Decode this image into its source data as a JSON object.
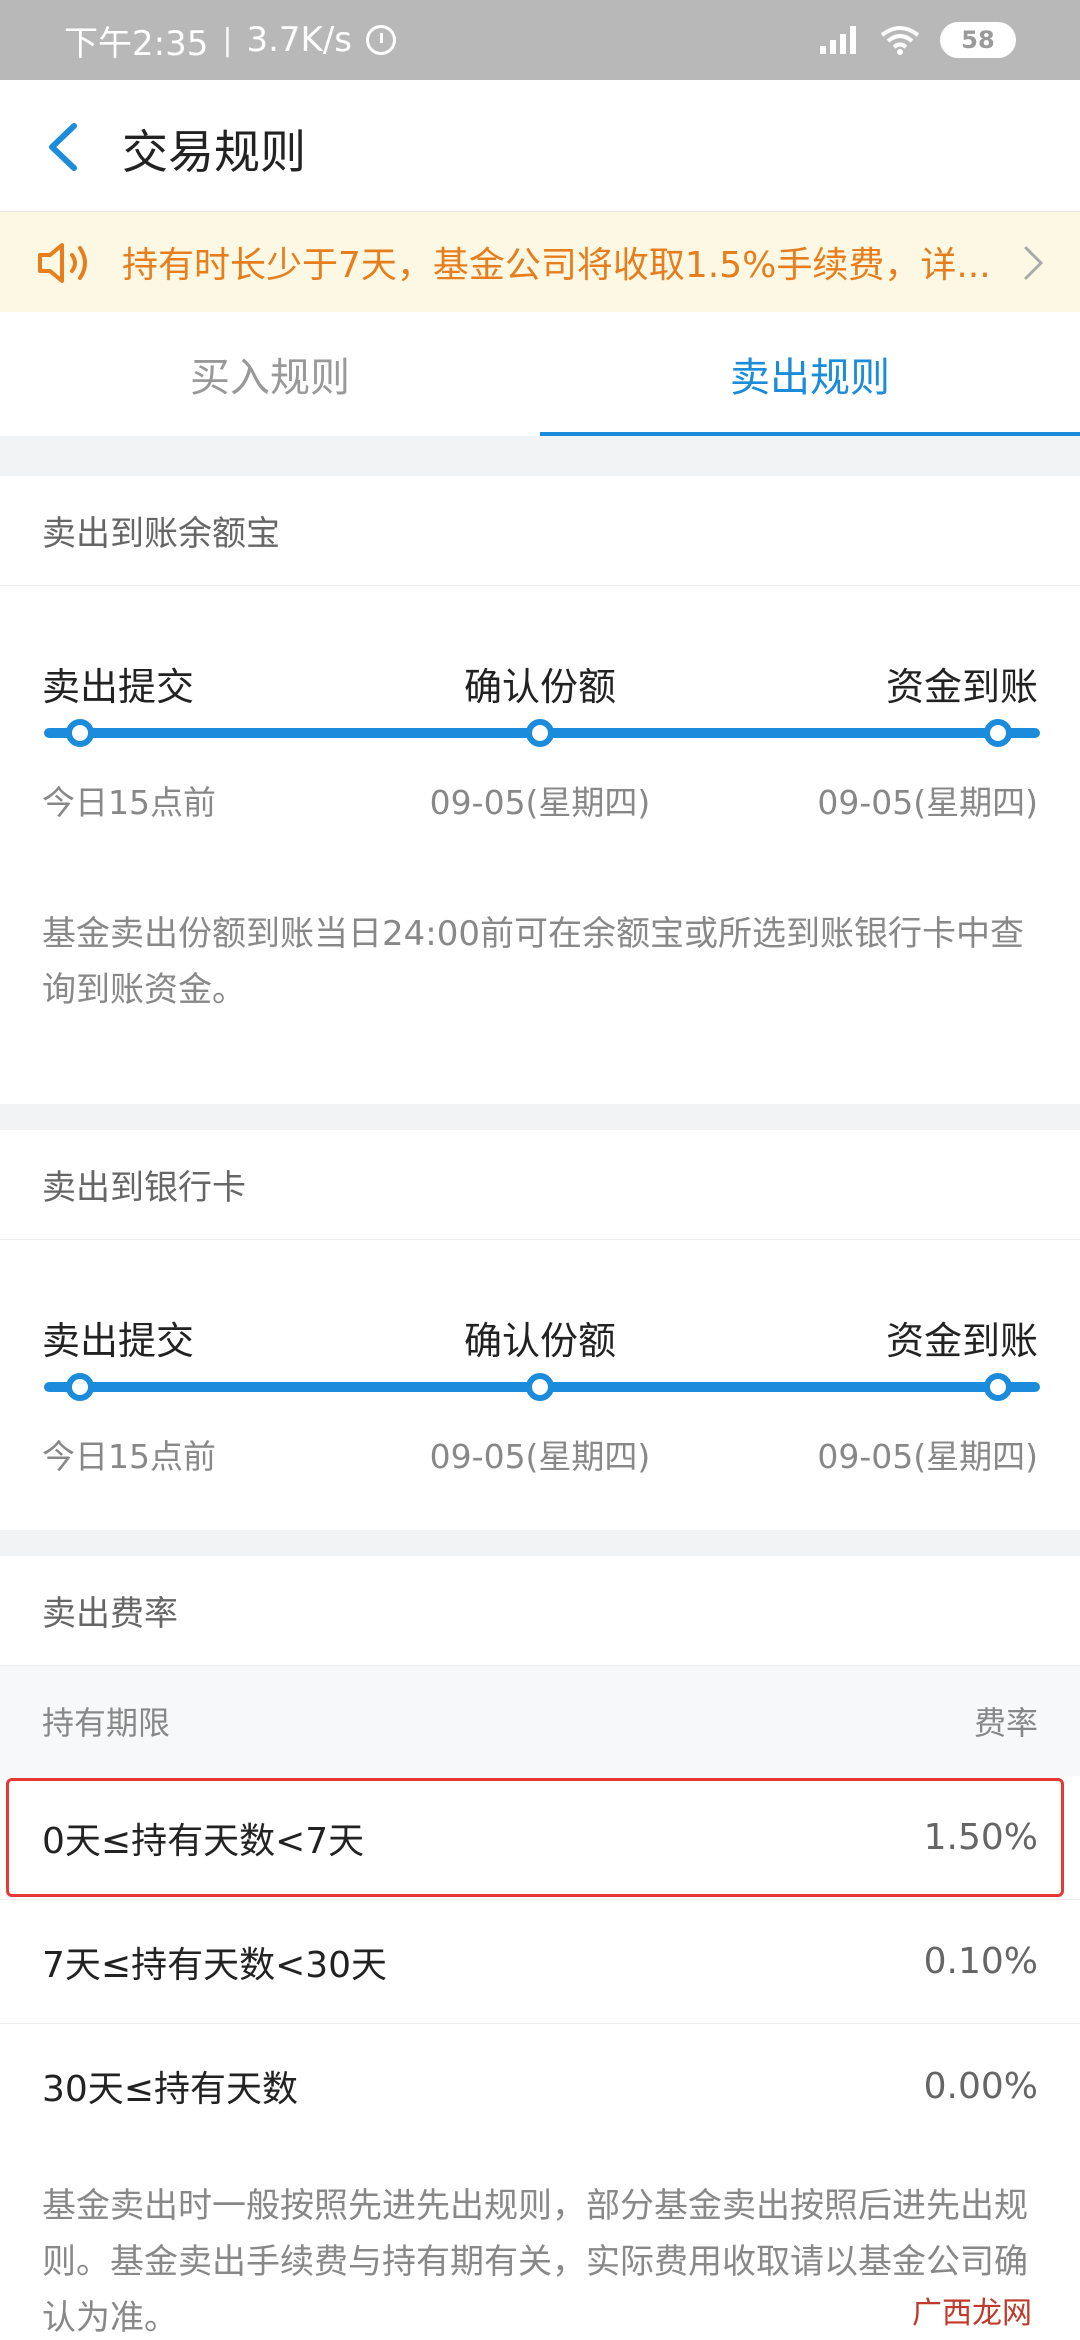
{
  "status_bar": {
    "time": "下午2:35",
    "speed": "3.7K/s",
    "battery": "58"
  },
  "header": {
    "title": "交易规则"
  },
  "notice": {
    "text": "持有时长少于7天，基金公司将收取1.5%手续费，详..."
  },
  "tabs": [
    {
      "label": "买入规则",
      "active": false
    },
    {
      "label": "卖出规则",
      "active": true
    }
  ],
  "sections": {
    "yuebao": {
      "title": "卖出到账余额宝",
      "steps": [
        {
          "label": "卖出提交",
          "date": "今日15点前"
        },
        {
          "label": "确认份额",
          "date": "09-05(星期四)"
        },
        {
          "label": "资金到账",
          "date": "09-05(星期四)"
        }
      ],
      "note": "基金卖出份额到账当日24:00前可在余额宝或所选到账银行卡中查询到账资金。"
    },
    "bank": {
      "title": "卖出到银行卡",
      "steps": [
        {
          "label": "卖出提交",
          "date": "今日15点前"
        },
        {
          "label": "确认份额",
          "date": "09-05(星期四)"
        },
        {
          "label": "资金到账",
          "date": "09-05(星期四)"
        }
      ]
    },
    "fee": {
      "title": "卖出费率",
      "col_period": "持有期限",
      "col_rate": "费率",
      "rows": [
        {
          "period": "0天≤持有天数<7天",
          "rate": "1.50%"
        },
        {
          "period": "7天≤持有天数<30天",
          "rate": "0.10%"
        },
        {
          "period": "30天≤持有天数",
          "rate": "0.00%"
        }
      ],
      "note": "基金卖出时一般按照先进先出规则，部分基金卖出按照后进先出规则。基金卖出手续费与持有期有关，实际费用收取请以基金公司确认为准。"
    }
  },
  "watermark": "广西龙网",
  "colors": {
    "accent": "#1a8cdb",
    "notice_text": "#e67e1e",
    "notice_bg": "#fdf8e4",
    "highlight": "#e53935"
  }
}
